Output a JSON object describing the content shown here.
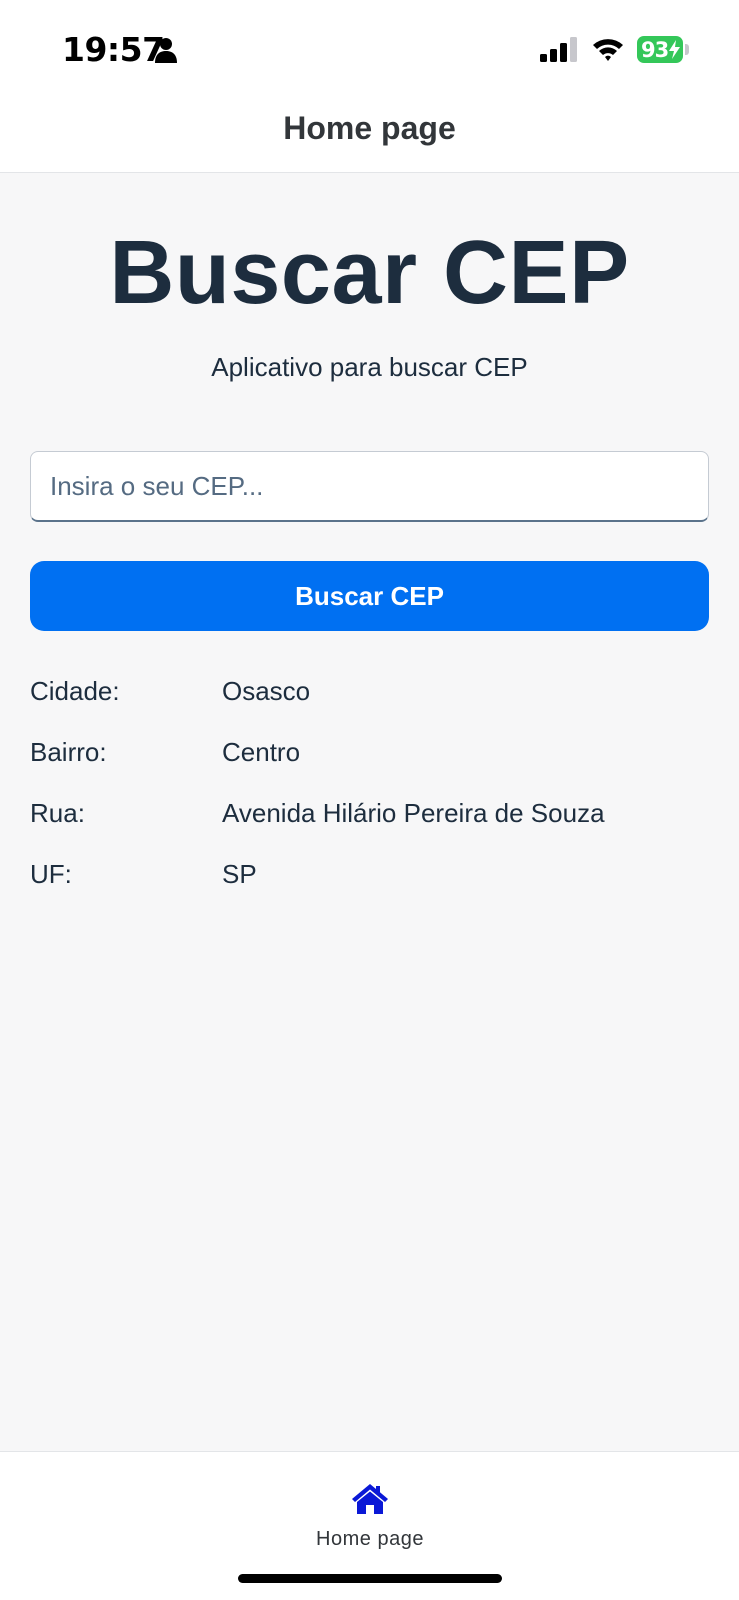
{
  "status_bar": {
    "time": "19:57",
    "battery_percent": "93",
    "battery_color": "#34c759"
  },
  "header": {
    "title": "Home page"
  },
  "main": {
    "title": "Buscar CEP",
    "subtitle": "Aplicativo para buscar CEP",
    "cep_input": {
      "value": "",
      "placeholder": "Insira o seu CEP..."
    },
    "search_button_label": "Buscar CEP",
    "accent_color": "#0070f2",
    "results": [
      {
        "label": "Cidade:",
        "value": "Osasco"
      },
      {
        "label": "Bairro:",
        "value": "Centro"
      },
      {
        "label": "Rua:",
        "value": "Avenida Hilário Pereira de Souza"
      },
      {
        "label": "UF:",
        "value": "SP"
      }
    ]
  },
  "tab_bar": {
    "items": [
      {
        "label": "Home page",
        "icon": "home-icon",
        "active": true,
        "color": "#0a18d6"
      }
    ]
  }
}
